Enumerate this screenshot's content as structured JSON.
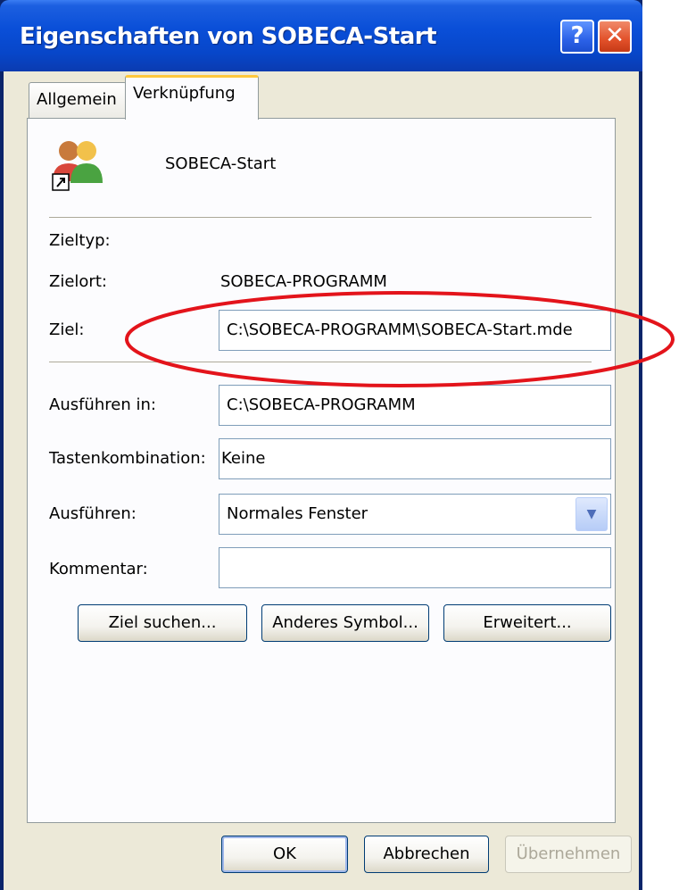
{
  "window": {
    "title": "Eigenschaften von SOBECA-Start",
    "help_glyph": "?",
    "close_glyph": "✕"
  },
  "tabs": [
    {
      "label": "Allgemein",
      "selected": false
    },
    {
      "label": "Verknüpfung",
      "selected": true
    }
  ],
  "shortcut": {
    "name": "SOBECA-Start",
    "icon": "users-shortcut-icon"
  },
  "fields": {
    "zieltyp_label": "Zieltyp:",
    "zieltyp_value": "",
    "zielort_label": "Zielort:",
    "zielort_value": "SOBECA-PROGRAMM",
    "ziel_label": "Ziel:",
    "ziel_value": "C:\\SOBECA-PROGRAMM\\SOBECA-Start.mde",
    "ausfuehren_in_label": "Ausführen in:",
    "ausfuehren_in_value": "C:\\SOBECA-PROGRAMM",
    "tastenkombination_label": "Tastenkombination:",
    "tastenkombination_value": "Keine",
    "ausfuehren_label": "Ausführen:",
    "ausfuehren_value": "Normales Fenster",
    "kommentar_label": "Kommentar:",
    "kommentar_value": ""
  },
  "buttons": {
    "ziel_suchen": "Ziel suchen...",
    "anderes_symbol": "Anderes Symbol...",
    "erweitert": "Erweitert...",
    "ok": "OK",
    "abbrechen": "Abbrechen",
    "uebernehmen": "Übernehmen"
  },
  "annotation": {
    "ellipse_color": "#e3141b"
  }
}
